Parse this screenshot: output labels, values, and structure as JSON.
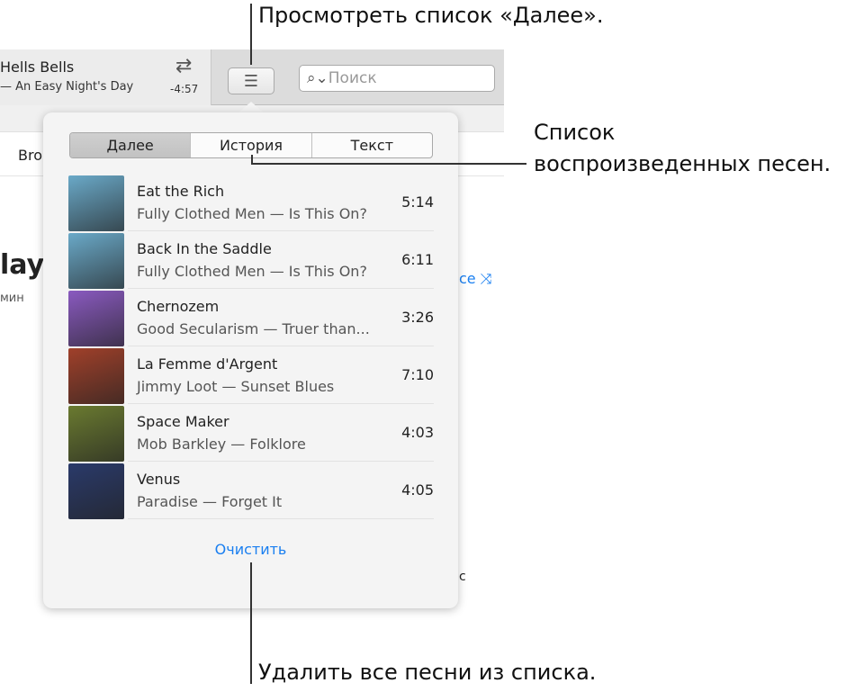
{
  "annotations": {
    "up_next": "Просмотреть список «Далее».",
    "history": [
      "Список",
      "воспроизведенных песен."
    ],
    "clear": "Удалить все песни из списка."
  },
  "now_playing": {
    "title": "Hells Bells",
    "subtitle": "— An Easy Night's Day",
    "remaining": "-4:57"
  },
  "search": {
    "placeholder": "Поиск"
  },
  "background": {
    "tab": "Bro",
    "heading": "layl",
    "meta": "мин",
    "shuffle": "ce",
    "genre_tail": "c"
  },
  "popover": {
    "tabs": [
      {
        "label": "Далее",
        "selected": true
      },
      {
        "label": "История",
        "selected": false
      },
      {
        "label": "Текст",
        "selected": false
      }
    ],
    "songs": [
      {
        "title": "Eat the Rich",
        "subtitle": "Fully Clothed Men — Is This On?",
        "duration": "5:14",
        "art_color": "#6aa9c8"
      },
      {
        "title": "Back In the Saddle",
        "subtitle": "Fully Clothed Men — Is This On?",
        "duration": "6:11",
        "art_color": "#6aa9c8"
      },
      {
        "title": "Chernozem",
        "subtitle": "Good Secularism — Truer than...",
        "duration": "3:26",
        "art_color": "#8a5ac0"
      },
      {
        "title": "La Femme d'Argent",
        "subtitle": "Jimmy Loot — Sunset Blues",
        "duration": "7:10",
        "art_color": "#a0402a"
      },
      {
        "title": "Space Maker",
        "subtitle": "Mob Barkley — Folklore",
        "duration": "4:03",
        "art_color": "#6a7a30"
      },
      {
        "title": "Venus",
        "subtitle": "Paradise — Forget It",
        "duration": "4:05",
        "art_color": "#2a3a6a"
      }
    ],
    "clear_label": "Очистить"
  },
  "colors": {
    "accent": "#1a7ff0"
  }
}
